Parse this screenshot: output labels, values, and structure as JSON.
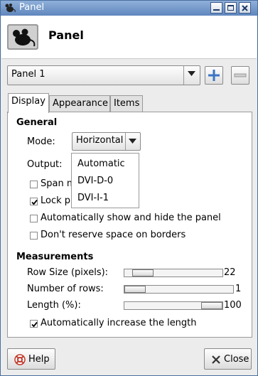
{
  "window": {
    "title": "Panel"
  },
  "header": {
    "title": "Panel"
  },
  "panel_select": {
    "value": "Panel 1"
  },
  "tabs": [
    {
      "label": "Display"
    },
    {
      "label": "Appearance"
    },
    {
      "label": "Items"
    }
  ],
  "general": {
    "heading": "General",
    "mode_label": "Mode:",
    "mode_value": "Horizontal",
    "output_label": "Output:",
    "output_options": [
      "Automatic",
      "DVI-D-0",
      "DVI-I-1"
    ],
    "span_label_partial": "Span m",
    "lock_label_partial": "Lock p",
    "lock_checked": true,
    "span_checked": false,
    "autohide_label": "Automatically show and hide the panel",
    "autohide_checked": false,
    "reserve_label": "Don't reserve space on borders",
    "reserve_checked": false
  },
  "measurements": {
    "heading": "Measurements",
    "row_size_label": "Row Size (pixels):",
    "row_size_value": "22",
    "row_size_fraction": 0.1,
    "rows_label": "Number of rows:",
    "rows_value": "1",
    "rows_fraction": 0.0,
    "length_label": "Length (%):",
    "length_value": "100",
    "length_fraction": 1.0,
    "auto_increase_label": "Automatically increase the length",
    "auto_increase_checked": true
  },
  "buttons": {
    "help": "Help",
    "close": "Close"
  },
  "icons": {
    "window_menu": "mouse-icon",
    "header": "mouse-icon",
    "add": "plus-icon",
    "remove": "minus-icon",
    "help": "lifebuoy-icon",
    "close": "close-x-icon"
  },
  "colors": {
    "titlebar": "#6f95c8",
    "accent": "#3c74c4"
  }
}
